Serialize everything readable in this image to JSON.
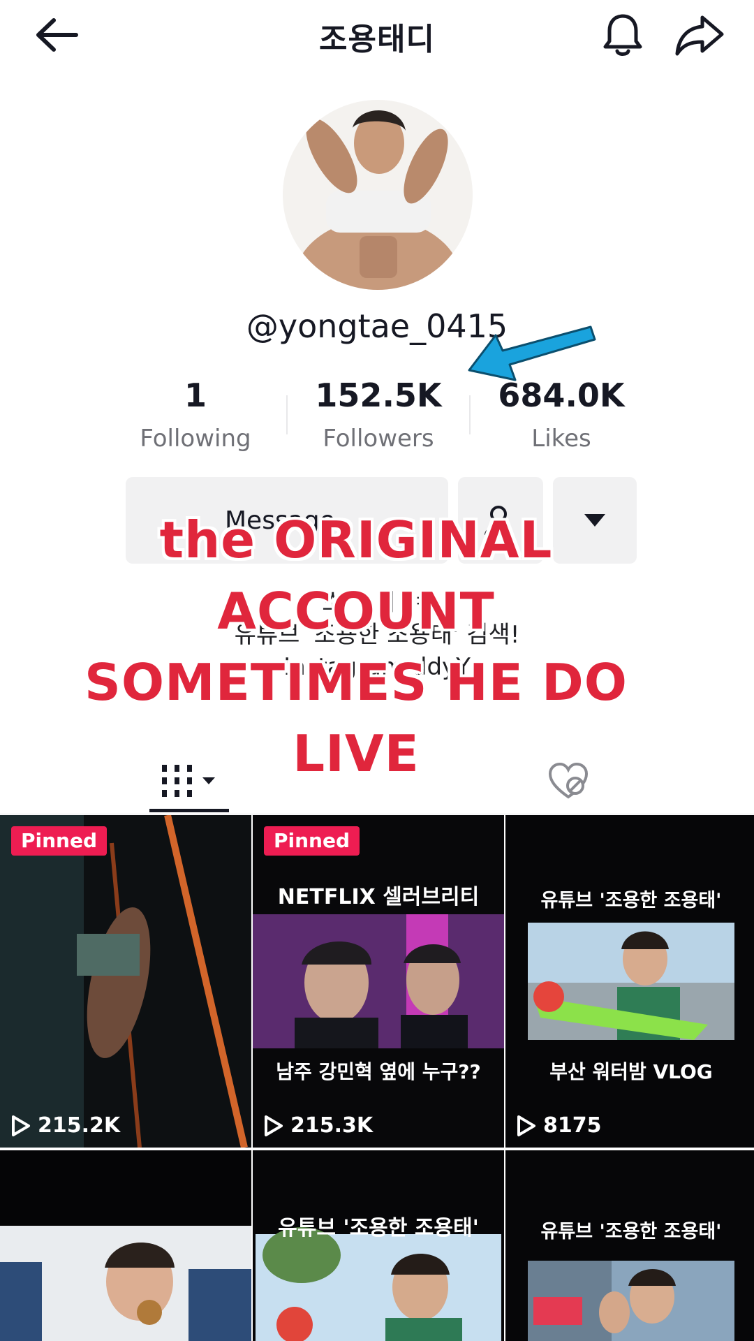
{
  "header": {
    "title": "조용태디",
    "icons": {
      "back": "arrow-left-icon",
      "notifications": "bell-icon",
      "share": "share-icon"
    }
  },
  "profile": {
    "username": "@yongtae_0415",
    "stats": [
      {
        "value": "1",
        "label": "Following"
      },
      {
        "value": "152.5K",
        "label": "Followers"
      },
      {
        "value": "684.0K",
        "label": "Likes"
      }
    ],
    "message_button": "Message",
    "bio": {
      "line1": "소  ㅏ  ㅣ  ㅕ",
      "line2": "유튜브 '조용한 조용태' 검색!",
      "line3": "Instagram   ddyY"
    }
  },
  "overlay": {
    "lines": [
      "the ORIGINAL",
      "ACCOUNT",
      "SOMETIMES HE DO",
      "LIVE"
    ],
    "color": "#e0263c"
  },
  "annotation_color": "#1aa3dd",
  "tabs": {
    "videos_icon": "grid-icon",
    "liked_icon": "hidden-heart-icon"
  },
  "videos": [
    {
      "pinned": "Pinned",
      "views": "215.2K",
      "caption_top": "",
      "caption_bottom": ""
    },
    {
      "pinned": "Pinned",
      "views": "215.3K",
      "caption_top": "NETFLIX 셀러브리티",
      "caption_bottom": "남주 강민혁 옆에 누구??"
    },
    {
      "pinned": "",
      "views": "8175",
      "caption_top": "유튜브 '조용한 조용태'",
      "caption_bottom": "부산 워터밤 VLOG"
    },
    {
      "pinned": "",
      "views": "",
      "caption_top": "",
      "caption_bottom": ""
    },
    {
      "pinned": "",
      "views": "",
      "caption_top": "유튜브 '조용한 조용태'",
      "caption_bottom": ""
    },
    {
      "pinned": "",
      "views": "",
      "caption_top": "유튜브 '조용한 조용태'",
      "caption_bottom": ""
    }
  ],
  "colors": {
    "pinned_badge": "#ee1d52",
    "text_primary": "#161823",
    "text_secondary": "#6f7076"
  }
}
